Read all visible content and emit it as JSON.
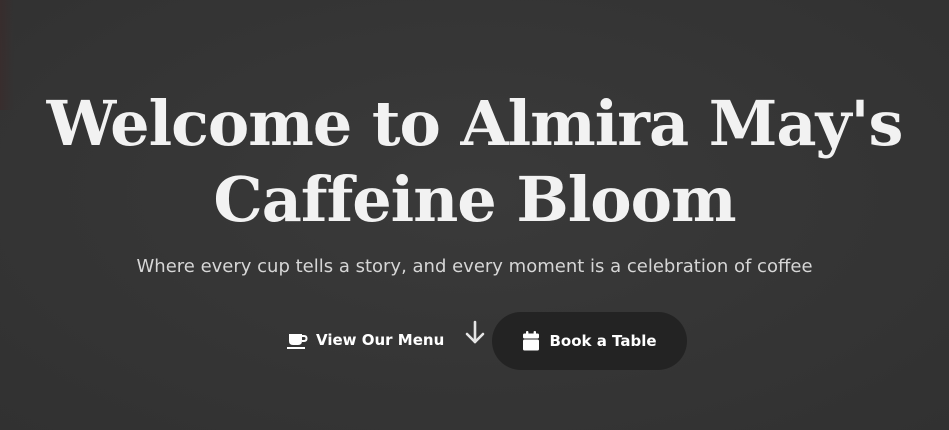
{
  "hero": {
    "title_line1": "Welcome to Almira May's",
    "title_line2": "Caffeine Bloom",
    "subtitle": "Where every cup tells a story, and every moment is a celebration of coffee"
  },
  "actions": {
    "menu_label": "View Our Menu",
    "menu_icon": "coffee-cup-icon",
    "scroll_icon": "arrow-down-icon",
    "book_label": "Book a Table",
    "book_icon": "calendar-icon"
  },
  "colors": {
    "background": "#363636",
    "text": "#f2f2f2",
    "subtitle": "#d6d6d6",
    "button": "#232323"
  }
}
